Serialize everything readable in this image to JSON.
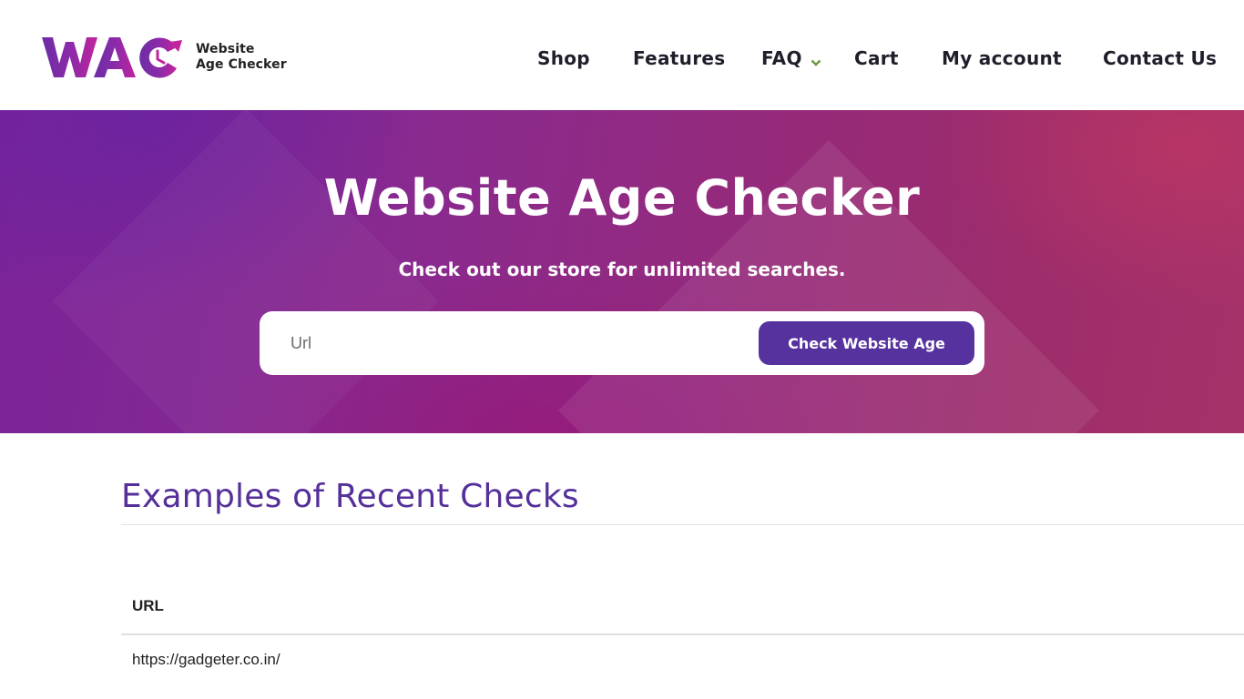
{
  "brand": {
    "logo_mark": "WAC",
    "logo_line1": "Website",
    "logo_line2": "Age Checker",
    "colors": {
      "primary": "#56329e",
      "magenta": "#b5229a",
      "accent_green": "#6a9a3a"
    }
  },
  "nav": {
    "items": [
      {
        "label": "Shop"
      },
      {
        "label": "Features"
      },
      {
        "label": "FAQ",
        "has_dropdown": true
      },
      {
        "label": "Cart"
      },
      {
        "label": "My account"
      },
      {
        "label": "Contact Us"
      }
    ]
  },
  "hero": {
    "title": "Website Age Checker",
    "subtitle": "Check out our store for unlimited searches.",
    "search": {
      "placeholder": "Url",
      "value": "",
      "button_label": "Check Website Age"
    }
  },
  "recent": {
    "title": "Examples of Recent Checks",
    "columns": [
      "URL"
    ],
    "rows": [
      {
        "url": "https://gadgeter.co.in/"
      }
    ]
  }
}
